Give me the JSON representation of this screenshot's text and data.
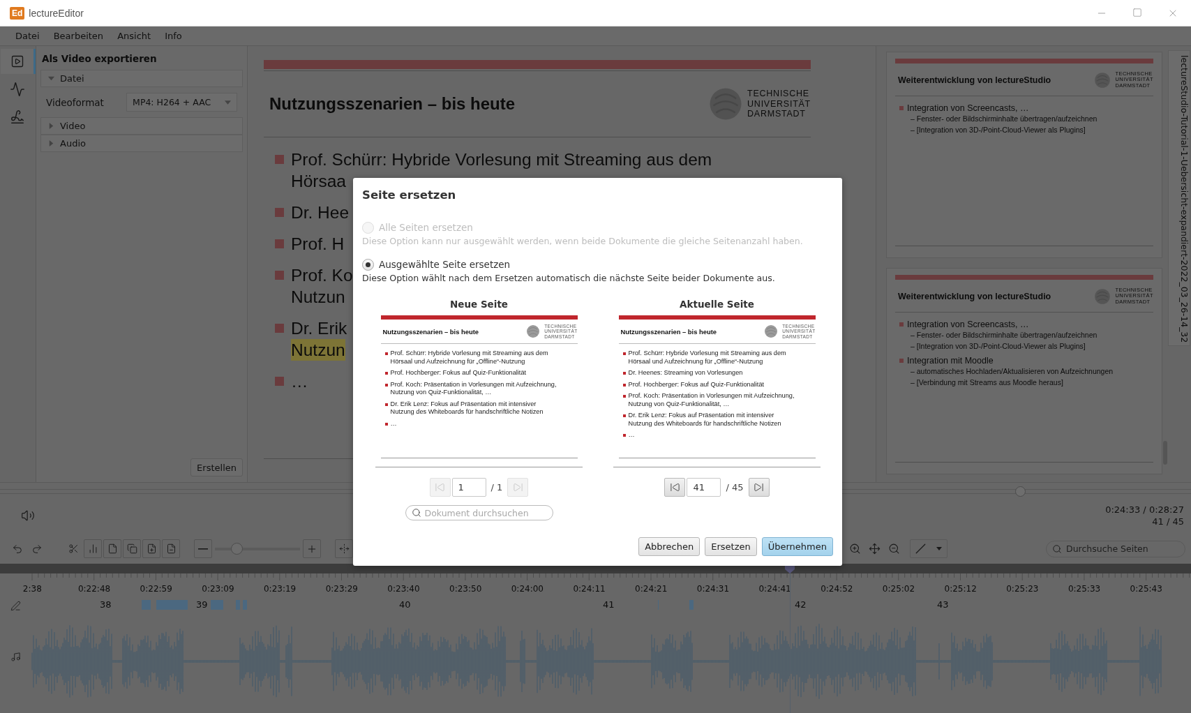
{
  "window": {
    "logo": "Ed",
    "title": "lectureEditor"
  },
  "menu": [
    "Datei",
    "Bearbeiten",
    "Ansicht",
    "Info"
  ],
  "tools": [
    {
      "kind": "export",
      "selected": true
    },
    {
      "kind": "waveform",
      "selected": false
    },
    {
      "kind": "signature",
      "selected": false
    }
  ],
  "export_panel": {
    "title": "Als Video exportieren",
    "sections": [
      {
        "label": "Datei",
        "expanded": true,
        "fields": [
          {
            "label": "Videoformat",
            "value": "MP4: H264 + AAC"
          }
        ]
      },
      {
        "label": "Video",
        "expanded": false
      },
      {
        "label": "Audio",
        "expanded": false
      }
    ],
    "button": "Erstellen"
  },
  "slide": {
    "title": "Nutzungsszenarien – bis heute",
    "logo_lines": [
      "TECHNISCHE",
      "UNIVERSITÄT",
      "DARMSTADT"
    ],
    "bullets": [
      {
        "lines": [
          {
            "text": "Prof. Schürr: Hybride Vorlesung mit Streaming aus dem",
            "highlighted": false
          },
          {
            "text": "Hörsaa",
            "highlighted": false
          }
        ]
      },
      {
        "lines": [
          {
            "text": "Dr. Hee",
            "highlighted": false
          }
        ]
      },
      {
        "lines": [
          {
            "text": "Prof. H",
            "highlighted": false
          }
        ]
      },
      {
        "lines": [
          {
            "text": "Prof. Ko",
            "highlighted": false
          },
          {
            "text": "Nutzun",
            "highlighted": false
          }
        ]
      },
      {
        "lines": [
          {
            "text": "Dr. Erik",
            "highlighted": false
          },
          {
            "text": "Nutzun",
            "highlighted": true
          }
        ]
      },
      {
        "lines": [
          {
            "text": "…",
            "highlighted": false
          }
        ]
      }
    ]
  },
  "thumbnails": [
    {
      "title": "Weiterentwicklung von lectureStudio",
      "logo_lines": [
        "TECHNISCHE",
        "UNIVERSITÄT",
        "DARMSTADT"
      ],
      "bullets": [
        {
          "text": "Integration von Screencasts, …",
          "subitems": [
            "– Fenster- oder Bildschirminhalte übertragen/aufzeichnen",
            "– [Integration von 3D-/Point-Cloud-Viewer als Plugins]"
          ]
        }
      ]
    },
    {
      "title": "Weiterentwicklung von lectureStudio",
      "logo_lines": [
        "TECHNISCHE",
        "UNIVERSITÄT",
        "DARMSTADT"
      ],
      "bullets": [
        {
          "text": "Integration von Screencasts, …",
          "subitems": [
            "– Fenster- oder Bildschirminhalte übertragen/aufzeichnen",
            "– [Integration von 3D-/Point-Cloud-Viewer als Plugins]"
          ]
        },
        {
          "text": "Integration mit Moodle",
          "subitems": [
            "– automatisches Hochladen/Aktualisieren von Aufzeichnungen",
            "– [Verbindung mit Streams aus Moodle heraus]"
          ]
        }
      ]
    }
  ],
  "document_tab": "lectureStudio-Tutorial-1-Uebersicht-expandiert-2022_03_26-14_32",
  "player": {
    "level": 0.86,
    "time": "0:24:33 / 0:28:27",
    "page": "41 / 45"
  },
  "toolbar": {
    "zoom": {
      "level": 0.22
    },
    "search": {
      "placeholder": "Durchsuche Seiten"
    }
  },
  "timeline": {
    "ticks": [
      "2:38",
      "0:22:48",
      "0:22:59",
      "0:23:09",
      "0:23:19",
      "0:23:29",
      "0:23:40",
      "0:23:50",
      "0:24:00",
      "0:24:11",
      "0:24:21",
      "0:24:31",
      "0:24:41",
      "0:24:52",
      "0:25:02",
      "0:25:12",
      "0:25:23",
      "0:25:33",
      "0:25:43"
    ],
    "pages": [
      "38",
      "39",
      "40",
      "41",
      "42",
      "43"
    ]
  },
  "dialog": {
    "title": "Seite ersetzen",
    "options": [
      {
        "label": "Alle Seiten ersetzen",
        "description": "Diese Option kann nur ausgewählt werden, wenn beide Dokumente die gleiche Seitenanzahl haben.",
        "selected": false,
        "disabled": true
      },
      {
        "label": "Ausgewählte Seite ersetzen",
        "description": "Diese Option wählt nach dem Ersetzen automatisch die nächste Seite beider Dokumente aus.",
        "selected": true,
        "disabled": false
      }
    ],
    "previews": [
      {
        "heading": "Neue Seite",
        "slide": {
          "title": "Nutzungsszenarien – bis heute",
          "logo_lines": [
            "TECHNISCHE",
            "UNIVERSITÄT",
            "DARMSTADT"
          ],
          "bullets": [
            [
              "Prof. Schürr: Hybride Vorlesung mit Streaming aus dem",
              "Hörsaal und Aufzeichnung für „Offline“-Nutzung"
            ],
            [
              "Prof. Hochberger: Fokus auf Quiz-Funktionalität"
            ],
            [
              "Prof. Koch: Präsentation in Vorlesungen mit Aufzeichnung,",
              "Nutzung von Quiz-Funktionalität, …"
            ],
            [
              "Dr. Erik Lenz: Fokus auf Präsentation mit intensiver",
              "Nutzung des Whiteboards für handschriftliche Notizen"
            ],
            [
              "…"
            ]
          ]
        },
        "page": "1",
        "total": "/ 1",
        "nav_disabled": true,
        "search": {
          "placeholder": "Dokument durchsuchen"
        }
      },
      {
        "heading": "Aktuelle Seite",
        "slide": {
          "title": "Nutzungsszenarien – bis heute",
          "logo_lines": [
            "TECHNISCHE",
            "UNIVERSITÄT",
            "DARMSTADT"
          ],
          "bullets": [
            [
              "Prof. Schürr: Hybride Vorlesung mit Streaming aus dem",
              "Hörsaal und Aufzeichnung für „Offline“-Nutzung"
            ],
            [
              "Dr. Heenes: Streaming von Vorlesungen"
            ],
            [
              "Prof. Hochberger: Fokus auf Quiz-Funktionalität"
            ],
            [
              "Prof. Koch: Präsentation in Vorlesungen mit Aufzeichnung,",
              "Nutzung von Quiz-Funktionalität, …"
            ],
            [
              "Dr. Erik Lenz: Fokus auf Präsentation mit intensiver",
              "Nutzung des Whiteboards für handschriftliche Notizen"
            ],
            [
              "…"
            ]
          ]
        },
        "page": "41",
        "total": "/ 45",
        "nav_disabled": false
      }
    ],
    "buttons": [
      {
        "label": "Abbrechen",
        "kind": "normal"
      },
      {
        "label": "Ersetzen",
        "kind": "normal"
      },
      {
        "label": "Übernehmen",
        "kind": "primary"
      }
    ]
  }
}
